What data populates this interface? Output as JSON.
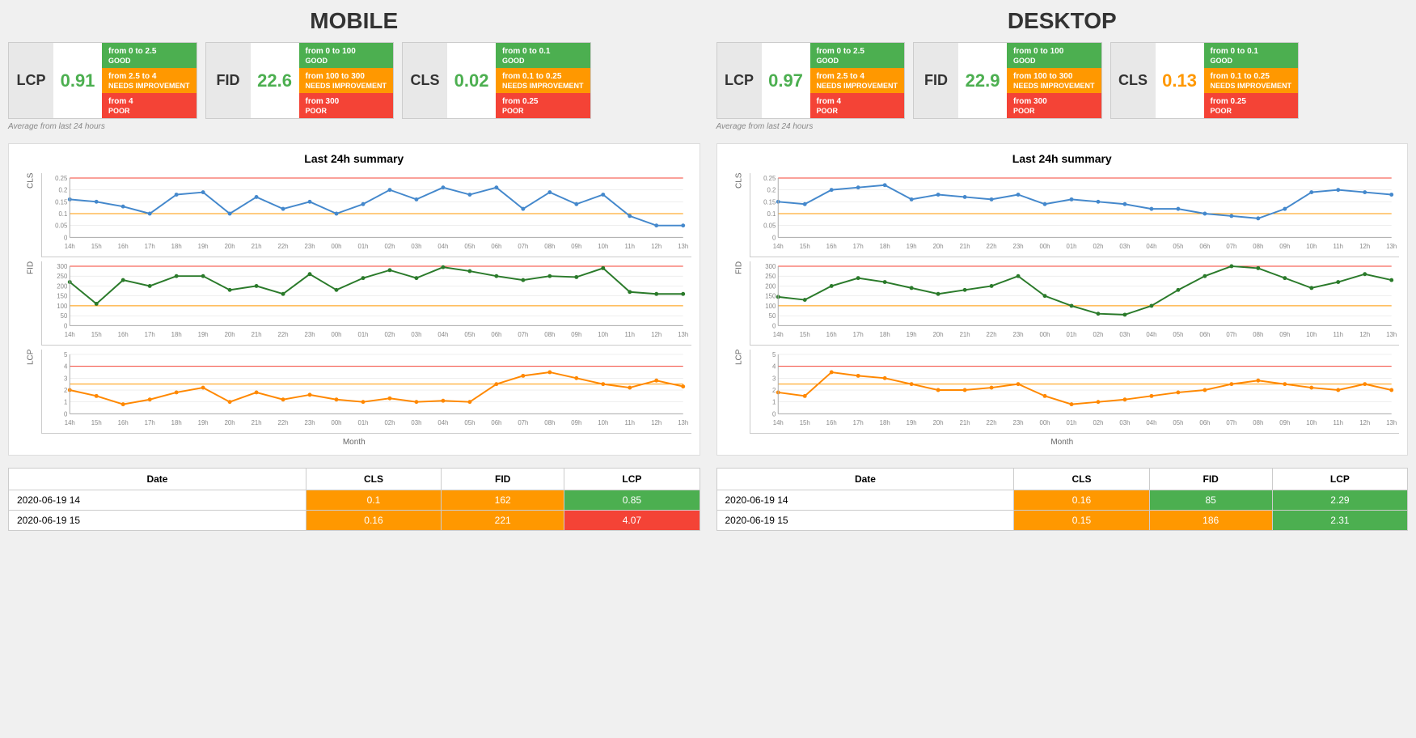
{
  "sections": [
    {
      "title": "MOBILE",
      "metrics": [
        {
          "label": "LCP",
          "value": "0.91",
          "valueClass": "good",
          "ranges": [
            {
              "label": "from 0 to 2.5",
              "rating": "GOOD",
              "colorClass": "green"
            },
            {
              "label": "from 2.5 to 4",
              "rating": "NEEDS IMPROVEMENT",
              "colorClass": "yellow"
            },
            {
              "label": "from 4",
              "rating": "POOR",
              "colorClass": "red"
            }
          ]
        },
        {
          "label": "FID",
          "value": "22.6",
          "valueClass": "good",
          "ranges": [
            {
              "label": "from 0 to 100",
              "rating": "GOOD",
              "colorClass": "green"
            },
            {
              "label": "from 100 to 300",
              "rating": "NEEDS IMPROVEMENT",
              "colorClass": "yellow"
            },
            {
              "label": "from 300",
              "rating": "POOR",
              "colorClass": "red"
            }
          ]
        },
        {
          "label": "CLS",
          "value": "0.02",
          "valueClass": "good",
          "ranges": [
            {
              "label": "from 0 to 0.1",
              "rating": "GOOD",
              "colorClass": "green"
            },
            {
              "label": "from 0.1 to 0.25",
              "rating": "NEEDS IMPROVEMENT",
              "colorClass": "yellow"
            },
            {
              "label": "from 0.25",
              "rating": "POOR",
              "colorClass": "red"
            }
          ]
        }
      ],
      "avgNote": "Average from last 24 hours",
      "chartTitle": "Last 24h summary",
      "xLabels": [
        "14h",
        "15h",
        "16h",
        "17h",
        "18h",
        "19h",
        "20h",
        "21h",
        "22h",
        "23h",
        "00h",
        "01h",
        "02h",
        "03h",
        "04h",
        "05h",
        "06h",
        "07h",
        "08h",
        "09h",
        "10h",
        "11h",
        "12h",
        "13h"
      ],
      "clsData": [
        0.16,
        0.15,
        0.13,
        0.1,
        0.18,
        0.19,
        0.1,
        0.17,
        0.12,
        0.15,
        0.1,
        0.14,
        0.2,
        0.16,
        0.21,
        0.18,
        0.21,
        0.12,
        0.19,
        0.14,
        0.18,
        0.09,
        0.05,
        0.05
      ],
      "fidData": [
        220,
        110,
        230,
        200,
        250,
        250,
        180,
        200,
        160,
        260,
        180,
        240,
        280,
        240,
        295,
        275,
        250,
        230,
        250,
        245,
        290,
        170,
        160,
        160
      ],
      "lcpData": [
        2.0,
        1.5,
        0.8,
        1.2,
        1.8,
        2.2,
        1.0,
        1.8,
        1.2,
        1.6,
        1.2,
        1.0,
        1.3,
        1.0,
        1.1,
        1.0,
        2.5,
        3.2,
        3.5,
        3.0,
        2.5,
        2.2,
        2.8,
        2.3
      ],
      "tableHeaders": [
        "Date",
        "CLS",
        "FID",
        "LCP"
      ],
      "tableRows": [
        {
          "date": "2020-06-19 14",
          "cls": "0.1",
          "clsClass": "td-yellow",
          "fid": "162",
          "fidClass": "td-yellow",
          "lcp": "0.85",
          "lcpClass": "td-green"
        },
        {
          "date": "2020-06-19 15",
          "cls": "0.16",
          "clsClass": "td-yellow",
          "fid": "221",
          "fidClass": "td-yellow",
          "lcp": "4.07",
          "lcpClass": "td-red"
        }
      ]
    },
    {
      "title": "DESKTOP",
      "metrics": [
        {
          "label": "LCP",
          "value": "0.97",
          "valueClass": "good",
          "ranges": [
            {
              "label": "from 0 to 2.5",
              "rating": "GOOD",
              "colorClass": "green"
            },
            {
              "label": "from 2.5 to 4",
              "rating": "NEEDS IMPROVEMENT",
              "colorClass": "yellow"
            },
            {
              "label": "from 4",
              "rating": "POOR",
              "colorClass": "red"
            }
          ]
        },
        {
          "label": "FID",
          "value": "22.9",
          "valueClass": "good",
          "ranges": [
            {
              "label": "from 0 to 100",
              "rating": "GOOD",
              "colorClass": "green"
            },
            {
              "label": "from 100 to 300",
              "rating": "NEEDS IMPROVEMENT",
              "colorClass": "yellow"
            },
            {
              "label": "from 300",
              "rating": "POOR",
              "colorClass": "red"
            }
          ]
        },
        {
          "label": "CLS",
          "value": "0.13",
          "valueClass": "needs",
          "ranges": [
            {
              "label": "from 0 to 0.1",
              "rating": "GOOD",
              "colorClass": "green"
            },
            {
              "label": "from 0.1 to 0.25",
              "rating": "NEEDS IMPROVEMENT",
              "colorClass": "yellow"
            },
            {
              "label": "from 0.25",
              "rating": "POOR",
              "colorClass": "red"
            }
          ]
        }
      ],
      "avgNote": "Average from last 24 hours",
      "chartTitle": "Last 24h summary",
      "xLabels": [
        "14h",
        "15h",
        "16h",
        "17h",
        "18h",
        "19h",
        "20h",
        "21h",
        "22h",
        "23h",
        "00h",
        "01h",
        "02h",
        "03h",
        "04h",
        "05h",
        "06h",
        "07h",
        "08h",
        "09h",
        "10h",
        "11h",
        "12h",
        "13h"
      ],
      "clsData": [
        0.15,
        0.14,
        0.2,
        0.21,
        0.22,
        0.16,
        0.18,
        0.17,
        0.16,
        0.18,
        0.14,
        0.16,
        0.15,
        0.14,
        0.12,
        0.12,
        0.1,
        0.09,
        0.08,
        0.12,
        0.19,
        0.2,
        0.19,
        0.18
      ],
      "fidData": [
        145,
        130,
        200,
        240,
        220,
        190,
        160,
        180,
        200,
        250,
        150,
        100,
        60,
        55,
        100,
        180,
        250,
        300,
        290,
        240,
        190,
        220,
        260,
        230
      ],
      "lcpData": [
        1.8,
        1.5,
        3.5,
        3.2,
        3.0,
        2.5,
        2.0,
        2.0,
        2.2,
        2.5,
        1.5,
        0.8,
        1.0,
        1.2,
        1.5,
        1.8,
        2.0,
        2.5,
        2.8,
        2.5,
        2.2,
        2.0,
        2.5,
        2.0
      ],
      "tableHeaders": [
        "Date",
        "CLS",
        "FID",
        "LCP"
      ],
      "tableRows": [
        {
          "date": "2020-06-19 14",
          "cls": "0.16",
          "clsClass": "td-yellow",
          "fid": "85",
          "fidClass": "td-green",
          "lcp": "2.29",
          "lcpClass": "td-green"
        },
        {
          "date": "2020-06-19 15",
          "cls": "0.15",
          "clsClass": "td-yellow",
          "fid": "186",
          "fidClass": "td-yellow",
          "lcp": "2.31",
          "lcpClass": "td-green"
        }
      ]
    }
  ]
}
